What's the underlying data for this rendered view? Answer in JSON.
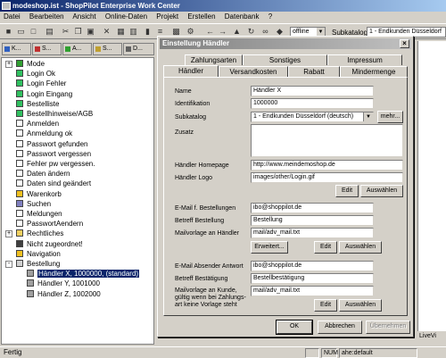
{
  "window": {
    "title": "modeshop.ist - ShopPilot Enterprise Work Center"
  },
  "menu": [
    "Datei",
    "Bearbeiten",
    "Ansicht",
    "Online-Daten",
    "Projekt",
    "Erstellen",
    "Datenbank",
    "?"
  ],
  "toolbar": {
    "mode": "offline",
    "subkatalog_label": "Subkatalog",
    "subkatalog_value": "1 - Endkunden Düsseldorf"
  },
  "left_tabs": [
    {
      "label": "K...",
      "color": "#3060c0"
    },
    {
      "label": "S...",
      "color": "#c03030"
    },
    {
      "label": "A...",
      "color": "#30a030"
    },
    {
      "label": "S...",
      "color": "#c0a030"
    },
    {
      "label": "D...",
      "color": "#606060"
    }
  ],
  "tree": [
    {
      "label": "Mode",
      "pm": "+",
      "color": "#30a030"
    },
    {
      "label": "Login Ok",
      "pm": "",
      "color": "#30c060"
    },
    {
      "label": "Login Fehler",
      "pm": "",
      "color": "#30c060"
    },
    {
      "label": "Login Eingang",
      "pm": "",
      "color": "#30c060"
    },
    {
      "label": "Bestelliste",
      "pm": "",
      "color": "#30c060"
    },
    {
      "label": "Bestellhinweise/AGB",
      "pm": "",
      "color": "#30c060"
    },
    {
      "label": "Anmelden",
      "pm": "",
      "color": "#ffffff"
    },
    {
      "label": "Anmeldung ok",
      "pm": "",
      "color": "#ffffff"
    },
    {
      "label": "Passwort gefunden",
      "pm": "",
      "color": "#ffffff"
    },
    {
      "label": "Passwort vergessen",
      "pm": "",
      "color": "#ffffff"
    },
    {
      "label": "Fehler pw vergessen.",
      "pm": "",
      "color": "#ffffff"
    },
    {
      "label": "Daten ändern",
      "pm": "",
      "color": "#ffffff"
    },
    {
      "label": "Daten sind geändert",
      "pm": "",
      "color": "#ffffff"
    },
    {
      "label": "Warenkorb",
      "pm": "",
      "color": "#f0c020"
    },
    {
      "label": "Suchen",
      "pm": "",
      "color": "#8080c0"
    },
    {
      "label": "Meldungen",
      "pm": "",
      "color": "#ffffff"
    },
    {
      "label": "PasswortAendern",
      "pm": "",
      "color": "#ffffff"
    },
    {
      "label": "Rechtliches",
      "pm": "+",
      "color": "#f0d060"
    },
    {
      "label": "Nicht zugeordnet!",
      "pm": "",
      "color": "#404040"
    },
    {
      "label": "Navigation",
      "pm": "",
      "color": "#f0c020"
    },
    {
      "label": "Bestellung",
      "pm": "-",
      "color": "#d0d0d0"
    },
    {
      "label": "Händler X, 1000000, (standard)",
      "pm": "",
      "color": "#a0a0a0",
      "selected": true,
      "indent": true
    },
    {
      "label": "Händler Y, 1001000",
      "pm": "",
      "color": "#a0a0a0",
      "indent": true
    },
    {
      "label": "Händler Z, 1002000",
      "pm": "",
      "color": "#a0a0a0",
      "indent": true
    }
  ],
  "right_panel": {
    "live_tab": "LiveVi"
  },
  "status": {
    "text": "Fertig",
    "num": "NUM",
    "user": "ahe:default"
  },
  "dialog": {
    "title": "Einstellung Händler",
    "close": "×",
    "tabs_row1": [
      "Zahlungsarten",
      "Sonstiges",
      "Impressum"
    ],
    "tabs_row2": [
      "Händler",
      "Versandkosten",
      "Rabatt",
      "Mindermenge"
    ],
    "fields": {
      "name_label": "Name",
      "name": "Händler X",
      "id_label": "Identifikation",
      "id": "1000000",
      "subkatalog_label": "Subkatalog",
      "subkatalog": "1 - Endkunden Düsseldorf (deutsch)",
      "more_btn": "mehr...",
      "zusatz_label": "Zusatz",
      "zusatz": "",
      "homepage_label": "Händler Homepage",
      "homepage": "http://www.meindemoshop.de",
      "logo_label": "Händler Logo",
      "logo": "images/other/Login.gif",
      "email_best_label": "E-Mail f. Bestellungen",
      "email_best": "ibo@shoppilot.de",
      "betreff_best_label": "Betreff Bestellung",
      "betreff_best": "Bestellung",
      "mailvorlage_label": "Mailvorlage an Händler",
      "mailvorlage": "mail/adv_mail.txt",
      "erweitert_btn": "Erweitert...",
      "email_abs_label": "E-Mail Absender Antwort",
      "email_abs": "ibo@shoppilot.de",
      "betreff_bestaet_label": "Betreff Bestätigung",
      "betreff_bestaet": "Bestellbestätigung",
      "mailvorlage_kunde_label1": "Mailvorlage an Kunde,",
      "mailvorlage_kunde_label2": "gültig wenn bei Zahlungs-",
      "mailvorlage_kunde_label3": "art keine Vorlage steht",
      "mailvorlage_kunde": "mail/adv_mail.txt"
    },
    "edit_btn": "Edit",
    "auswaehlen_btn": "Auswählen",
    "ok_btn": "OK",
    "cancel_btn": "Abbrechen",
    "apply_btn": "Übernehmen"
  }
}
